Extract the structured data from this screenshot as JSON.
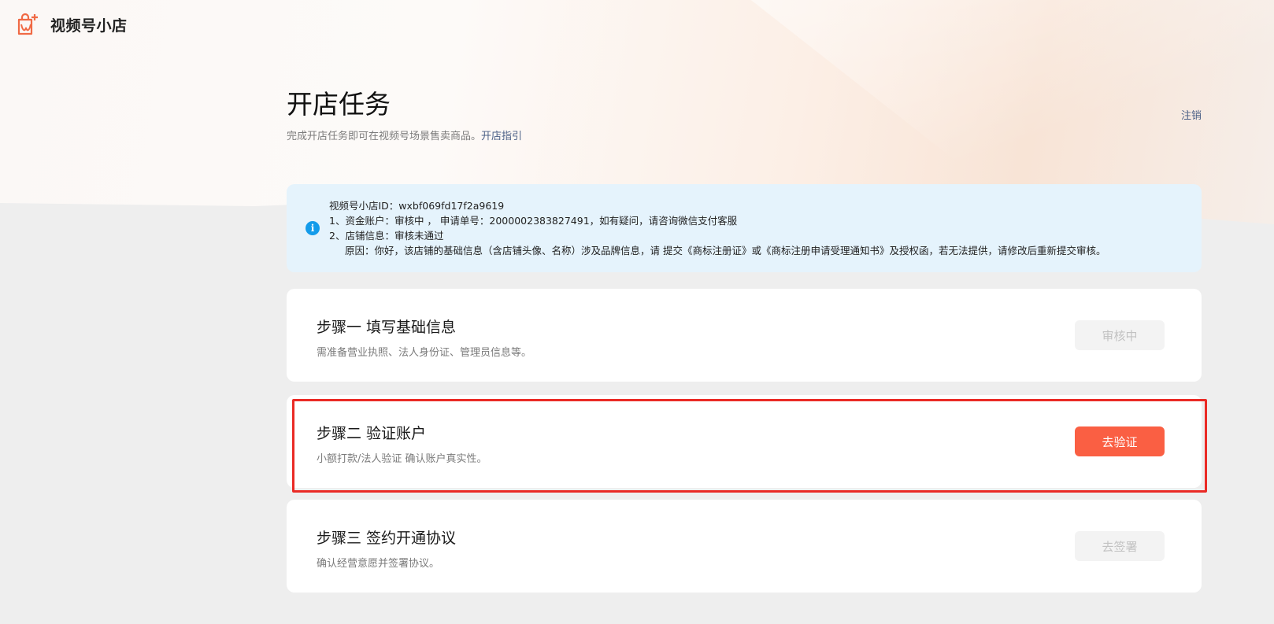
{
  "header": {
    "brand_name": "视频号小店",
    "logo_icon": "shop-bag-icon",
    "accent_color": "#fa5f43"
  },
  "page": {
    "title": "开店任务",
    "subtitle_text": "完成开店任务即可在视频号场景售卖商品。",
    "subtitle_link": "开店指引",
    "logout_label": "注销"
  },
  "info": {
    "icon": "info-icon",
    "line1": "视频号小店ID：wxbf069fd17f2a9619",
    "line2": "1、资金账户：审核中 ， 申请单号：2000002383827491，如有疑问，请咨询微信支付客服",
    "line3": "2、店铺信息：审核未通过",
    "line4": "原因：你好，该店铺的基础信息（含店铺头像、名称）涉及品牌信息，请 提交《商标注册证》或《商标注册申请受理通知书》及授权函，若无法提供，请修改后重新提交审核。"
  },
  "steps": [
    {
      "title": "步骤一 填写基础信息",
      "desc": "需准备营业执照、法人身份证、管理员信息等。",
      "button": "审核中"
    },
    {
      "title": "步骤二 验证账户",
      "desc": "小额打款/法人验证 确认账户真实性。",
      "button": "去验证"
    },
    {
      "title": "步骤三 签约开通协议",
      "desc": "确认经营意愿并签署协议。",
      "button": "去签署"
    }
  ]
}
